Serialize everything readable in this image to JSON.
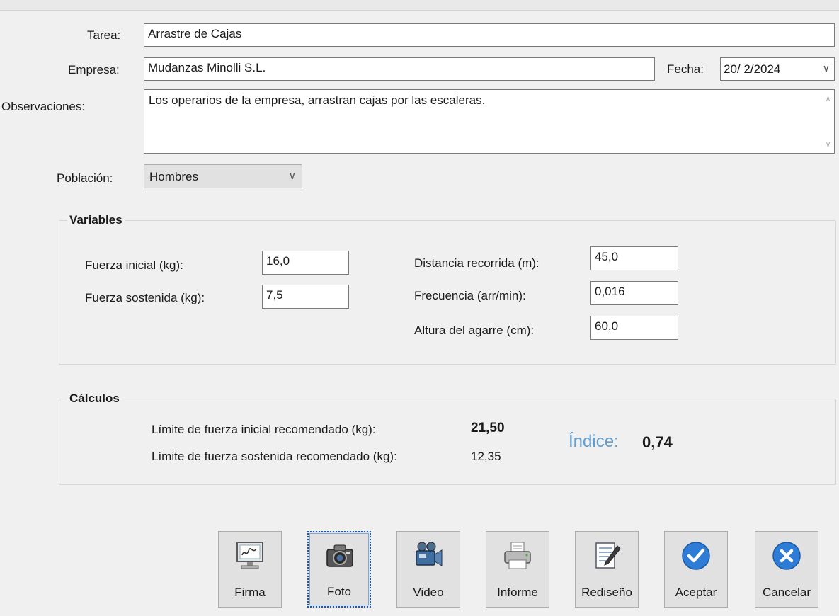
{
  "form": {
    "tarea": {
      "label": "Tarea:",
      "value": "Arrastre de Cajas"
    },
    "empresa": {
      "label": "Empresa:",
      "value": "Mudanzas Minolli S.L."
    },
    "fecha": {
      "label": "Fecha:",
      "value": "20/ 2/2024"
    },
    "observaciones": {
      "label": "Observaciones:",
      "value": "Los operarios de la empresa, arrastran cajas por las escaleras."
    },
    "poblacion": {
      "label": "Población:",
      "value": "Hombres"
    }
  },
  "variables": {
    "title": "Variables",
    "fuerza_inicial": {
      "label": "Fuerza inicial (kg):",
      "value": "16,0"
    },
    "fuerza_sostenida": {
      "label": "Fuerza sostenida (kg):",
      "value": "7,5"
    },
    "distancia": {
      "label": "Distancia recorrida (m):",
      "value": "45,0"
    },
    "frecuencia": {
      "label": "Frecuencia (arr/min):",
      "value": "0,016"
    },
    "altura": {
      "label": "Altura del agarre (cm):",
      "value": "60,0"
    }
  },
  "calculos": {
    "title": "Cálculos",
    "limite_inicial": {
      "label": "Límite de fuerza inicial recomendado (kg):",
      "value": "21,50"
    },
    "limite_sostenida": {
      "label": "Límite de fuerza sostenida recomendado (kg):",
      "value": "12,35"
    },
    "indice": {
      "label": "Índice:",
      "value": "0,74"
    }
  },
  "buttons": [
    {
      "label": "Firma",
      "icon": "signature-monitor-icon"
    },
    {
      "label": "Foto",
      "icon": "camera-icon"
    },
    {
      "label": "Video",
      "icon": "video-camera-icon"
    },
    {
      "label": "Informe",
      "icon": "printer-icon"
    },
    {
      "label": "Rediseño",
      "icon": "notepad-pencil-icon"
    },
    {
      "label": "Aceptar",
      "icon": "checkmark-icon"
    },
    {
      "label": "Cancelar",
      "icon": "close-icon"
    }
  ],
  "colors": {
    "indice_label": "#5f9fd3",
    "button_face": "#e1e1e1",
    "accept_blue": "#2e7cd6"
  }
}
